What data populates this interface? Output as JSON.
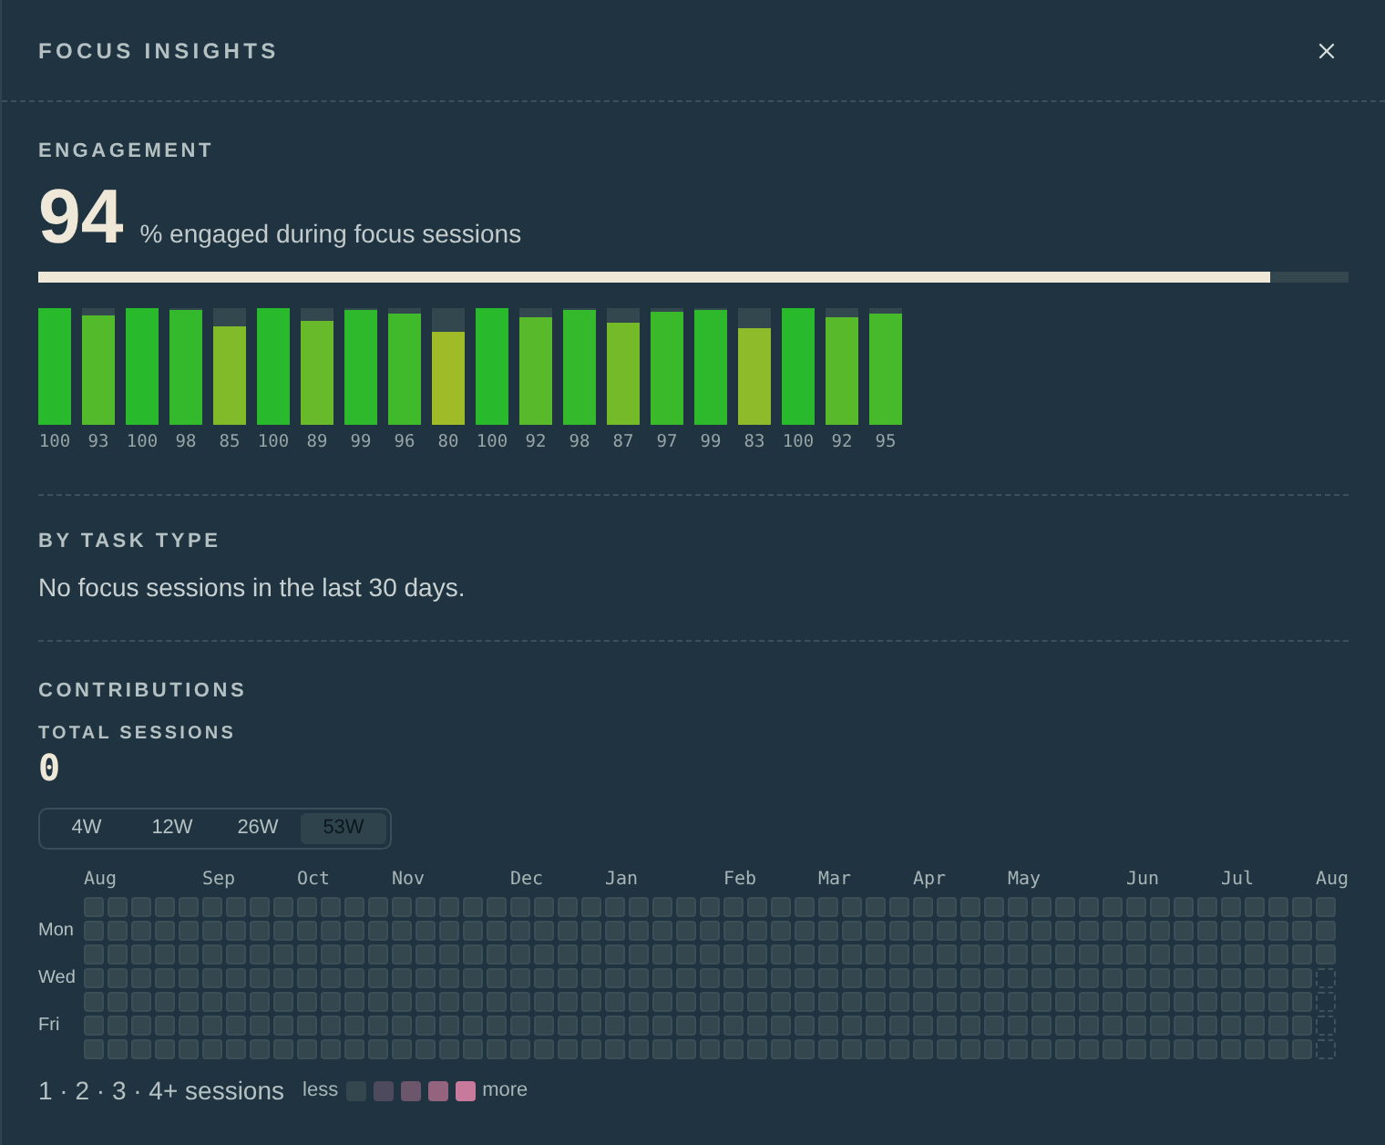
{
  "window": {
    "title": "FOCUS INSIGHTS"
  },
  "engagement": {
    "heading": "ENGAGEMENT",
    "value": "94",
    "caption": "% engaged during focus sessions",
    "level": 0.94,
    "bars": [
      {
        "level": 1,
        "reading": "100"
      },
      {
        "level": 0.93,
        "reading": "93"
      },
      {
        "level": 1,
        "reading": "100"
      },
      {
        "level": 0.98,
        "reading": "98"
      },
      {
        "level": 0.85,
        "reading": "85"
      },
      {
        "level": 1,
        "reading": "100"
      },
      {
        "level": 0.89,
        "reading": "89"
      },
      {
        "level": 0.99,
        "reading": "99"
      },
      {
        "level": 0.96,
        "reading": "96"
      },
      {
        "level": 0.8,
        "reading": "80"
      },
      {
        "level": 1,
        "reading": "100"
      },
      {
        "level": 0.92,
        "reading": "92"
      },
      {
        "level": 0.98,
        "reading": "98"
      },
      {
        "level": 0.87,
        "reading": "87"
      },
      {
        "level": 0.97,
        "reading": "97"
      },
      {
        "level": 0.99,
        "reading": "99"
      },
      {
        "level": 0.83,
        "reading": "83"
      },
      {
        "level": 1,
        "reading": "100"
      },
      {
        "level": 0.92,
        "reading": "92"
      },
      {
        "level": 0.95,
        "reading": "95"
      }
    ]
  },
  "by_task_type": {
    "heading": "BY TASK TYPE",
    "message": "No focus sessions in the last 30 days."
  },
  "contributions": {
    "heading": "CONTRIBUTIONS",
    "total_label": "TOTAL SESSIONS",
    "total_value": "0",
    "ranges": [
      {
        "label": "4W",
        "selected": false
      },
      {
        "label": "12W",
        "selected": false
      },
      {
        "label": "26W",
        "selected": false
      },
      {
        "label": "53W",
        "selected": true
      }
    ],
    "day_labels": [
      "Mon",
      "Wed",
      "Fri"
    ],
    "weeks": [
      {
        "month": "Aug",
        "days": [
          {
            "kind": "empty"
          },
          {
            "kind": "empty"
          },
          {
            "kind": "empty"
          },
          {
            "kind": "empty"
          },
          {
            "kind": "empty"
          },
          {
            "kind": "empty"
          },
          {
            "kind": "empty"
          }
        ]
      },
      {
        "days": [
          {
            "kind": "empty"
          },
          {
            "kind": "empty"
          },
          {
            "kind": "empty"
          },
          {
            "kind": "empty"
          },
          {
            "kind": "empty"
          },
          {
            "kind": "empty"
          },
          {
            "kind": "empty"
          }
        ]
      },
      {
        "days": [
          {
            "kind": "empty"
          },
          {
            "kind": "empty"
          },
          {
            "kind": "empty"
          },
          {
            "kind": "empty"
          },
          {
            "kind": "empty"
          },
          {
            "kind": "empty"
          },
          {
            "kind": "empty"
          }
        ]
      },
      {
        "days": [
          {
            "kind": "empty"
          },
          {
            "kind": "empty"
          },
          {
            "kind": "empty"
          },
          {
            "kind": "empty"
          },
          {
            "kind": "empty"
          },
          {
            "kind": "empty"
          },
          {
            "kind": "empty"
          }
        ]
      },
      {
        "days": [
          {
            "kind": "empty"
          },
          {
            "kind": "empty"
          },
          {
            "kind": "empty"
          },
          {
            "kind": "empty"
          },
          {
            "kind": "empty"
          },
          {
            "kind": "empty"
          },
          {
            "kind": "empty"
          }
        ]
      },
      {
        "month": "Sep",
        "days": [
          {
            "kind": "empty"
          },
          {
            "kind": "empty"
          },
          {
            "kind": "empty"
          },
          {
            "kind": "empty"
          },
          {
            "kind": "empty"
          },
          {
            "kind": "empty"
          },
          {
            "kind": "empty"
          }
        ]
      },
      {
        "days": [
          {
            "kind": "empty"
          },
          {
            "kind": "empty"
          },
          {
            "kind": "empty"
          },
          {
            "kind": "empty"
          },
          {
            "kind": "empty"
          },
          {
            "kind": "empty"
          },
          {
            "kind": "empty"
          }
        ]
      },
      {
        "days": [
          {
            "kind": "empty"
          },
          {
            "kind": "empty"
          },
          {
            "kind": "empty"
          },
          {
            "kind": "empty"
          },
          {
            "kind": "empty"
          },
          {
            "kind": "empty"
          },
          {
            "kind": "empty"
          }
        ]
      },
      {
        "days": [
          {
            "kind": "empty"
          },
          {
            "kind": "empty"
          },
          {
            "kind": "empty"
          },
          {
            "kind": "empty"
          },
          {
            "kind": "empty"
          },
          {
            "kind": "empty"
          },
          {
            "kind": "empty"
          }
        ]
      },
      {
        "month": "Oct",
        "days": [
          {
            "kind": "empty"
          },
          {
            "kind": "empty"
          },
          {
            "kind": "empty"
          },
          {
            "kind": "empty"
          },
          {
            "kind": "empty"
          },
          {
            "kind": "empty"
          },
          {
            "kind": "empty"
          }
        ]
      },
      {
        "days": [
          {
            "kind": "empty"
          },
          {
            "kind": "empty"
          },
          {
            "kind": "empty"
          },
          {
            "kind": "empty"
          },
          {
            "kind": "empty"
          },
          {
            "kind": "empty"
          },
          {
            "kind": "empty"
          }
        ]
      },
      {
        "days": [
          {
            "kind": "empty"
          },
          {
            "kind": "empty"
          },
          {
            "kind": "empty"
          },
          {
            "kind": "empty"
          },
          {
            "kind": "empty"
          },
          {
            "kind": "empty"
          },
          {
            "kind": "empty"
          }
        ]
      },
      {
        "days": [
          {
            "kind": "empty"
          },
          {
            "kind": "empty"
          },
          {
            "kind": "empty"
          },
          {
            "kind": "empty"
          },
          {
            "kind": "empty"
          },
          {
            "kind": "empty"
          },
          {
            "kind": "empty"
          }
        ]
      },
      {
        "month": "Nov",
        "days": [
          {
            "kind": "empty"
          },
          {
            "kind": "empty"
          },
          {
            "kind": "empty"
          },
          {
            "kind": "empty"
          },
          {
            "kind": "empty"
          },
          {
            "kind": "empty"
          },
          {
            "kind": "empty"
          }
        ]
      },
      {
        "days": [
          {
            "kind": "empty"
          },
          {
            "kind": "empty"
          },
          {
            "kind": "empty"
          },
          {
            "kind": "empty"
          },
          {
            "kind": "empty"
          },
          {
            "kind": "empty"
          },
          {
            "kind": "empty"
          }
        ]
      },
      {
        "days": [
          {
            "kind": "empty"
          },
          {
            "kind": "empty"
          },
          {
            "kind": "empty"
          },
          {
            "kind": "empty"
          },
          {
            "kind": "empty"
          },
          {
            "kind": "empty"
          },
          {
            "kind": "empty"
          }
        ]
      },
      {
        "days": [
          {
            "kind": "empty"
          },
          {
            "kind": "empty"
          },
          {
            "kind": "empty"
          },
          {
            "kind": "empty"
          },
          {
            "kind": "empty"
          },
          {
            "kind": "empty"
          },
          {
            "kind": "empty"
          }
        ]
      },
      {
        "days": [
          {
            "kind": "empty"
          },
          {
            "kind": "empty"
          },
          {
            "kind": "empty"
          },
          {
            "kind": "empty"
          },
          {
            "kind": "empty"
          },
          {
            "kind": "empty"
          },
          {
            "kind": "empty"
          }
        ]
      },
      {
        "month": "Dec",
        "days": [
          {
            "kind": "empty"
          },
          {
            "kind": "empty"
          },
          {
            "kind": "empty"
          },
          {
            "kind": "empty"
          },
          {
            "kind": "empty"
          },
          {
            "kind": "empty"
          },
          {
            "kind": "empty"
          }
        ]
      },
      {
        "days": [
          {
            "kind": "empty"
          },
          {
            "kind": "empty"
          },
          {
            "kind": "empty"
          },
          {
            "kind": "empty"
          },
          {
            "kind": "empty"
          },
          {
            "kind": "empty"
          },
          {
            "kind": "empty"
          }
        ]
      },
      {
        "days": [
          {
            "kind": "empty"
          },
          {
            "kind": "empty"
          },
          {
            "kind": "empty"
          },
          {
            "kind": "empty"
          },
          {
            "kind": "empty"
          },
          {
            "kind": "empty"
          },
          {
            "kind": "empty"
          }
        ]
      },
      {
        "days": [
          {
            "kind": "empty"
          },
          {
            "kind": "empty"
          },
          {
            "kind": "empty"
          },
          {
            "kind": "empty"
          },
          {
            "kind": "empty"
          },
          {
            "kind": "empty"
          },
          {
            "kind": "empty"
          }
        ]
      },
      {
        "month": "Jan",
        "days": [
          {
            "kind": "empty"
          },
          {
            "kind": "empty"
          },
          {
            "kind": "empty"
          },
          {
            "kind": "empty"
          },
          {
            "kind": "empty"
          },
          {
            "kind": "empty"
          },
          {
            "kind": "empty"
          }
        ]
      },
      {
        "days": [
          {
            "kind": "empty"
          },
          {
            "kind": "empty"
          },
          {
            "kind": "empty"
          },
          {
            "kind": "empty"
          },
          {
            "kind": "empty"
          },
          {
            "kind": "empty"
          },
          {
            "kind": "empty"
          }
        ]
      },
      {
        "days": [
          {
            "kind": "empty"
          },
          {
            "kind": "empty"
          },
          {
            "kind": "empty"
          },
          {
            "kind": "empty"
          },
          {
            "kind": "empty"
          },
          {
            "kind": "empty"
          },
          {
            "kind": "empty"
          }
        ]
      },
      {
        "days": [
          {
            "kind": "empty"
          },
          {
            "kind": "empty"
          },
          {
            "kind": "empty"
          },
          {
            "kind": "empty"
          },
          {
            "kind": "empty"
          },
          {
            "kind": "empty"
          },
          {
            "kind": "empty"
          }
        ]
      },
      {
        "days": [
          {
            "kind": "empty"
          },
          {
            "kind": "empty"
          },
          {
            "kind": "empty"
          },
          {
            "kind": "empty"
          },
          {
            "kind": "empty"
          },
          {
            "kind": "empty"
          },
          {
            "kind": "empty"
          }
        ]
      },
      {
        "month": "Feb",
        "days": [
          {
            "kind": "empty"
          },
          {
            "kind": "empty"
          },
          {
            "kind": "empty"
          },
          {
            "kind": "empty"
          },
          {
            "kind": "empty"
          },
          {
            "kind": "empty"
          },
          {
            "kind": "empty"
          }
        ]
      },
      {
        "days": [
          {
            "kind": "empty"
          },
          {
            "kind": "empty"
          },
          {
            "kind": "empty"
          },
          {
            "kind": "empty"
          },
          {
            "kind": "empty"
          },
          {
            "kind": "empty"
          },
          {
            "kind": "empty"
          }
        ]
      },
      {
        "days": [
          {
            "kind": "empty"
          },
          {
            "kind": "empty"
          },
          {
            "kind": "empty"
          },
          {
            "kind": "empty"
          },
          {
            "kind": "empty"
          },
          {
            "kind": "empty"
          },
          {
            "kind": "empty"
          }
        ]
      },
      {
        "days": [
          {
            "kind": "empty"
          },
          {
            "kind": "empty"
          },
          {
            "kind": "empty"
          },
          {
            "kind": "empty"
          },
          {
            "kind": "empty"
          },
          {
            "kind": "empty"
          },
          {
            "kind": "empty"
          }
        ]
      },
      {
        "month": "Mar",
        "days": [
          {
            "kind": "empty"
          },
          {
            "kind": "empty"
          },
          {
            "kind": "empty"
          },
          {
            "kind": "empty"
          },
          {
            "kind": "empty"
          },
          {
            "kind": "empty"
          },
          {
            "kind": "empty"
          }
        ]
      },
      {
        "days": [
          {
            "kind": "empty"
          },
          {
            "kind": "empty"
          },
          {
            "kind": "empty"
          },
          {
            "kind": "empty"
          },
          {
            "kind": "empty"
          },
          {
            "kind": "empty"
          },
          {
            "kind": "empty"
          }
        ]
      },
      {
        "days": [
          {
            "kind": "empty"
          },
          {
            "kind": "empty"
          },
          {
            "kind": "empty"
          },
          {
            "kind": "empty"
          },
          {
            "kind": "empty"
          },
          {
            "kind": "empty"
          },
          {
            "kind": "empty"
          }
        ]
      },
      {
        "days": [
          {
            "kind": "empty"
          },
          {
            "kind": "empty"
          },
          {
            "kind": "empty"
          },
          {
            "kind": "empty"
          },
          {
            "kind": "empty"
          },
          {
            "kind": "empty"
          },
          {
            "kind": "empty"
          }
        ]
      },
      {
        "month": "Apr",
        "days": [
          {
            "kind": "empty"
          },
          {
            "kind": "empty"
          },
          {
            "kind": "empty"
          },
          {
            "kind": "empty"
          },
          {
            "kind": "empty"
          },
          {
            "kind": "empty"
          },
          {
            "kind": "empty"
          }
        ]
      },
      {
        "days": [
          {
            "kind": "empty"
          },
          {
            "kind": "empty"
          },
          {
            "kind": "empty"
          },
          {
            "kind": "empty"
          },
          {
            "kind": "empty"
          },
          {
            "kind": "empty"
          },
          {
            "kind": "empty"
          }
        ]
      },
      {
        "days": [
          {
            "kind": "empty"
          },
          {
            "kind": "empty"
          },
          {
            "kind": "empty"
          },
          {
            "kind": "empty"
          },
          {
            "kind": "empty"
          },
          {
            "kind": "empty"
          },
          {
            "kind": "empty"
          }
        ]
      },
      {
        "days": [
          {
            "kind": "empty"
          },
          {
            "kind": "empty"
          },
          {
            "kind": "empty"
          },
          {
            "kind": "empty"
          },
          {
            "kind": "empty"
          },
          {
            "kind": "empty"
          },
          {
            "kind": "empty"
          }
        ]
      },
      {
        "month": "May",
        "days": [
          {
            "kind": "empty"
          },
          {
            "kind": "empty"
          },
          {
            "kind": "empty"
          },
          {
            "kind": "empty"
          },
          {
            "kind": "empty"
          },
          {
            "kind": "empty"
          },
          {
            "kind": "empty"
          }
        ]
      },
      {
        "days": [
          {
            "kind": "empty"
          },
          {
            "kind": "empty"
          },
          {
            "kind": "empty"
          },
          {
            "kind": "empty"
          },
          {
            "kind": "empty"
          },
          {
            "kind": "empty"
          },
          {
            "kind": "empty"
          }
        ]
      },
      {
        "days": [
          {
            "kind": "empty"
          },
          {
            "kind": "empty"
          },
          {
            "kind": "empty"
          },
          {
            "kind": "empty"
          },
          {
            "kind": "empty"
          },
          {
            "kind": "empty"
          },
          {
            "kind": "empty"
          }
        ]
      },
      {
        "days": [
          {
            "kind": "empty"
          },
          {
            "kind": "empty"
          },
          {
            "kind": "empty"
          },
          {
            "kind": "empty"
          },
          {
            "kind": "empty"
          },
          {
            "kind": "empty"
          },
          {
            "kind": "empty"
          }
        ]
      },
      {
        "days": [
          {
            "kind": "empty"
          },
          {
            "kind": "empty"
          },
          {
            "kind": "empty"
          },
          {
            "kind": "empty"
          },
          {
            "kind": "empty"
          },
          {
            "kind": "empty"
          },
          {
            "kind": "empty"
          }
        ]
      },
      {
        "month": "Jun",
        "days": [
          {
            "kind": "empty"
          },
          {
            "kind": "empty"
          },
          {
            "kind": "empty"
          },
          {
            "kind": "empty"
          },
          {
            "kind": "empty"
          },
          {
            "kind": "empty"
          },
          {
            "kind": "empty"
          }
        ]
      },
      {
        "days": [
          {
            "kind": "empty"
          },
          {
            "kind": "empty"
          },
          {
            "kind": "empty"
          },
          {
            "kind": "empty"
          },
          {
            "kind": "empty"
          },
          {
            "kind": "empty"
          },
          {
            "kind": "empty"
          }
        ]
      },
      {
        "days": [
          {
            "kind": "empty"
          },
          {
            "kind": "empty"
          },
          {
            "kind": "empty"
          },
          {
            "kind": "empty"
          },
          {
            "kind": "empty"
          },
          {
            "kind": "empty"
          },
          {
            "kind": "empty"
          }
        ]
      },
      {
        "days": [
          {
            "kind": "empty"
          },
          {
            "kind": "empty"
          },
          {
            "kind": "empty"
          },
          {
            "kind": "empty"
          },
          {
            "kind": "empty"
          },
          {
            "kind": "empty"
          },
          {
            "kind": "empty"
          }
        ]
      },
      {
        "month": "Jul",
        "days": [
          {
            "kind": "empty"
          },
          {
            "kind": "empty"
          },
          {
            "kind": "empty"
          },
          {
            "kind": "empty"
          },
          {
            "kind": "empty"
          },
          {
            "kind": "empty"
          },
          {
            "kind": "empty"
          }
        ]
      },
      {
        "days": [
          {
            "kind": "empty"
          },
          {
            "kind": "empty"
          },
          {
            "kind": "empty"
          },
          {
            "kind": "empty"
          },
          {
            "kind": "empty"
          },
          {
            "kind": "empty"
          },
          {
            "kind": "empty"
          }
        ]
      },
      {
        "days": [
          {
            "kind": "empty"
          },
          {
            "kind": "empty"
          },
          {
            "kind": "empty"
          },
          {
            "kind": "empty"
          },
          {
            "kind": "empty"
          },
          {
            "kind": "empty"
          },
          {
            "kind": "empty"
          }
        ]
      },
      {
        "days": [
          {
            "kind": "empty"
          },
          {
            "kind": "empty"
          },
          {
            "kind": "empty"
          },
          {
            "kind": "empty"
          },
          {
            "kind": "empty"
          },
          {
            "kind": "empty"
          },
          {
            "kind": "empty"
          }
        ]
      },
      {
        "month": "Aug",
        "days": [
          {
            "kind": "empty"
          },
          {
            "kind": "empty"
          },
          {
            "kind": "empty"
          },
          {
            "kind": "future"
          },
          {
            "kind": "future"
          },
          {
            "kind": "future"
          },
          {
            "kind": "future"
          }
        ]
      }
    ],
    "legend": {
      "text": "1 · 2 · 3 · 4+ sessions",
      "less": "less",
      "more": "more",
      "swatches": [
        {
          "color": "#34464e"
        },
        {
          "color": "#4c4a5c"
        },
        {
          "color": "#6c566c"
        },
        {
          "color": "#94647f"
        },
        {
          "color": "#c87a9c"
        }
      ]
    }
  }
}
